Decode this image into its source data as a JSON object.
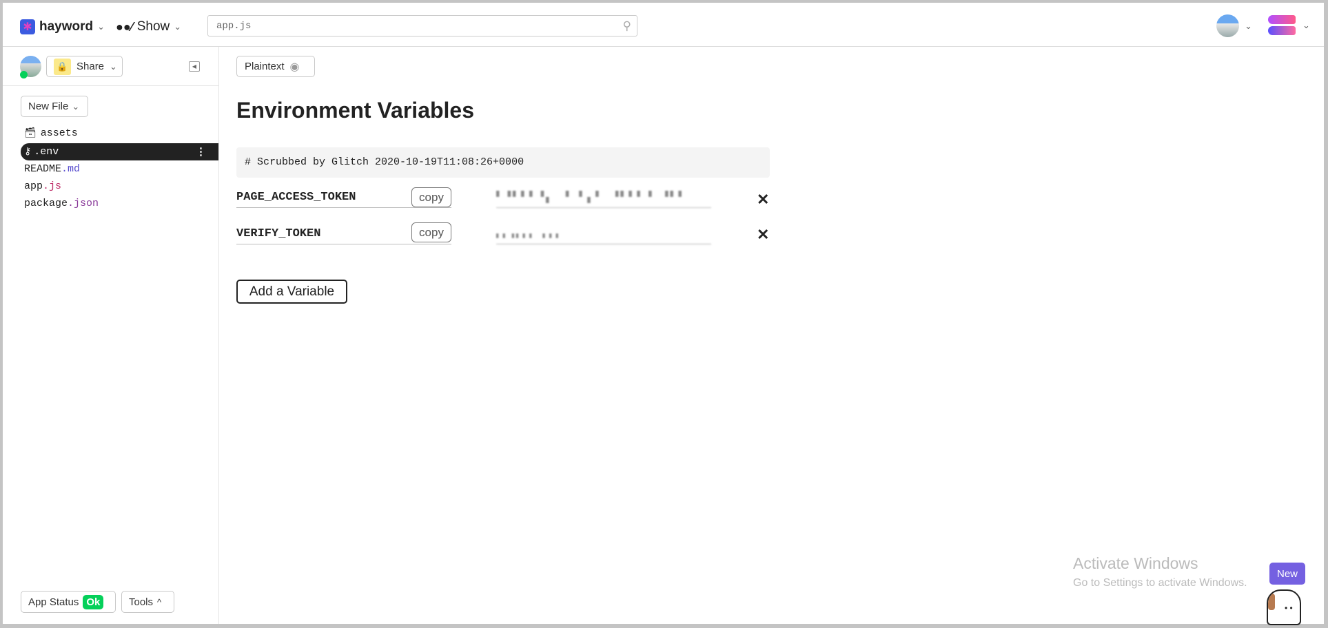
{
  "header": {
    "project_name": "hayword",
    "show_label": "Show",
    "search_value": "app.js",
    "icons": [
      "project-logo-icon",
      "glasses-icon",
      "search-icon",
      "user-avatar",
      "fish-logo-icon"
    ]
  },
  "sidebar": {
    "share_label": "Share",
    "new_file_label": "New File",
    "files": [
      {
        "name": "assets",
        "ext": ""
      },
      {
        "name": ".env",
        "ext": ""
      },
      {
        "name": "README",
        "ext": ".md"
      },
      {
        "name": "app",
        "ext": ".js"
      },
      {
        "name": "package",
        "ext": ".json"
      }
    ],
    "app_status_label": "App Status",
    "app_status_badge": "Ok",
    "tools_label": "Tools"
  },
  "main": {
    "plaintext_label": "Plaintext",
    "title": "Environment Variables",
    "comment": "# Scrubbed by Glitch 2020-10-19T11:08:26+0000",
    "variables": [
      {
        "key": "PAGE_ACCESS_TOKEN",
        "copy_label": "copy",
        "remove_label": "✕"
      },
      {
        "key": "VERIFY_TOKEN",
        "copy_label": "copy",
        "remove_label": "✕"
      }
    ],
    "add_label": "Add a Variable"
  },
  "overlay": {
    "activate_title": "Activate Windows",
    "activate_sub": "Go to Settings to activate Windows.",
    "new_badge": "New"
  },
  "colors": {
    "accent_purple": "#7460e1",
    "ok_green": "#05d05a",
    "selected_row": "#222222"
  }
}
